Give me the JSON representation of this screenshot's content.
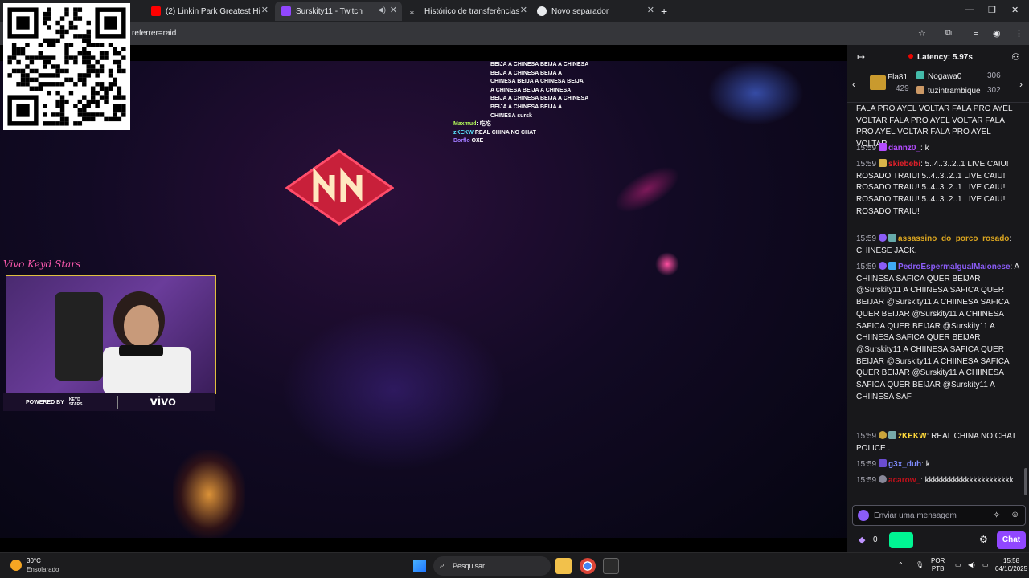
{
  "browser": {
    "tabs": [
      {
        "label": "(2) Linkin Park Greatest Hits 202",
        "icon": "youtube-icon",
        "color": "#ff0000"
      },
      {
        "label": "Surskity11 - Twitch",
        "icon": "twitch-icon",
        "color": "#9147ff",
        "active": true
      },
      {
        "label": "Histórico de transferências",
        "icon": "download-icon",
        "color": "#e8eaed"
      },
      {
        "label": "Novo separador",
        "icon": "chrome-icon",
        "color": "#e8eaed"
      }
    ],
    "url_fragment": "referrer=raid"
  },
  "video": {
    "overlay_chat": [
      "BEIJA A CHINESA   BEIJA A CHINESA",
      "   BEIJA A CHINESA    BEIJA A",
      "CHINESA   BEIJA A CHINESA   BEIJA",
      "A CHINESA    BEIJA A CHINESA",
      "BEIJA A CHINESA   BEIJA A CHINESA",
      "   BEIJA A CHINESA    BEIJA A",
      "CHINESA sursk"
    ],
    "overlay_users": [
      {
        "name": "Maxmud",
        "text": "吃吃"
      },
      {
        "name": "zKEKW",
        "text": "REAL CHINA NO CHAT"
      },
      {
        "name": "Dorflo",
        "text": "OXE"
      }
    ],
    "webcam": {
      "script_title": "Vivo Keyd Stars",
      "powered_by": "POWERED BY",
      "sponsor": "vivo",
      "team": "KEYD STARS"
    }
  },
  "chat": {
    "latency": "Latency: 5.97s",
    "leaderboard": [
      {
        "name": "Fla81",
        "count": "429"
      },
      {
        "name": "Nogawa0",
        "count": "306"
      },
      {
        "name": "tuzintrambique",
        "count": "302"
      }
    ],
    "messages": [
      {
        "time": "",
        "user": "",
        "text": "FALA PRO AYEL VOLTAR FALA PRO AYEL VOLTAR FALA PRO AYEL VOLTAR FALA PRO AYEL VOLTAR FALA PRO AYEL VOLTAR",
        "color": "#efeff1"
      },
      {
        "time": "15:59",
        "user": "dannz0_",
        "text": ": k",
        "color": "#b44cff"
      },
      {
        "time": "15:59",
        "user": "skiebebi",
        "text": ": 5..4..3..2..1 LIVE CAIU! ROSADO TRAIU! 5..4..3..2..1 LIVE CAIU! ROSADO TRAIU! 5..4..3..2..1 LIVE CAIU! ROSADO TRAIU! 5..4..3..2..1 LIVE CAIU! ROSADO TRAIU!",
        "color": "#e0202a"
      },
      {
        "time": "15:59",
        "user": "assassino_do_porco_rosado",
        "text": ": CHINESE JACK.",
        "color": "#daa520"
      },
      {
        "time": "15:59",
        "user": "PedroEspermalgualMaionese",
        "text": ": A CHIINESA SAFICA QUER BEIJAR @Surskity11 A CHIINESA SAFICA QUER BEIJAR @Surskity11 A CHIINESA SAFICA QUER BEIJAR @Surskity11 A CHIINESA SAFICA QUER BEIJAR @Surskity11 A CHIINESA SAFICA QUER BEIJAR @Surskity11 A CHIINESA SAFICA QUER BEIJAR @Surskity11 A CHIINESA SAFICA QUER BEIJAR @Surskity11 A CHIINESA SAFICA QUER BEIJAR @Surskity11 A CHIINESA SAF",
        "color": "#8a5cf6"
      },
      {
        "time": "15:59",
        "user": "zKEKW",
        "text": ": REAL CHINA NO CHAT POLICE .",
        "color": "#ffd93b"
      },
      {
        "time": "15:59",
        "user": "g3x_duh",
        "text": ": k",
        "color": "#7f8cff"
      },
      {
        "time": "15:59",
        "user": "acarow_",
        "text": ": kkkkkkkkkkkkkkkkkkkkkk",
        "color": "#c0101a"
      }
    ],
    "input_placeholder": "Enviar uma mensagem",
    "points": "0",
    "send_label": "Chat"
  },
  "taskbar": {
    "temp": "30°C",
    "weather": "Ensolarado",
    "search_label": "Pesquisar",
    "lang_top": "POR",
    "lang_bottom": "PTB",
    "time": "15:58",
    "date": "04/10/2025"
  }
}
